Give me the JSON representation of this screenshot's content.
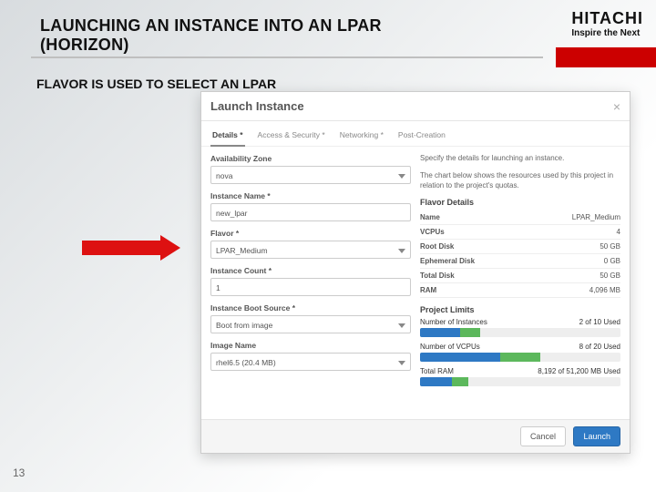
{
  "slide": {
    "title": "LAUNCHING AN INSTANCE INTO AN LPAR (HORIZON)",
    "subtitle": "FLAVOR IS USED TO SELECT AN LPAR",
    "page_number": "13"
  },
  "brand": {
    "logo": "HITACHI",
    "tagline": "Inspire the Next"
  },
  "modal": {
    "title": "Launch Instance",
    "close_glyph": "×",
    "tabs": {
      "details": "Details *",
      "access": "Access & Security *",
      "networking": "Networking *",
      "post": "Post-Creation"
    },
    "form": {
      "avail_zone": {
        "label": "Availability Zone",
        "value": "nova"
      },
      "instance_name": {
        "label": "Instance Name *",
        "value": "new_lpar"
      },
      "flavor": {
        "label": "Flavor *",
        "value": "LPAR_Medium"
      },
      "instance_count": {
        "label": "Instance Count *",
        "value": "1"
      },
      "boot_source": {
        "label": "Instance Boot Source *",
        "value": "Boot from image"
      },
      "image_name": {
        "label": "Image Name",
        "value": "rhel6.5 (20.4 MB)"
      }
    },
    "right": {
      "desc1": "Specify the details for launching an instance.",
      "desc2": "The chart below shows the resources used by this project in relation to the project's quotas.",
      "flavor_title": "Flavor Details",
      "flavor_rows": {
        "name_l": "Name",
        "name_v": "LPAR_Medium",
        "vcpu_l": "VCPUs",
        "vcpu_v": "4",
        "root_l": "Root Disk",
        "root_v": "50 GB",
        "eph_l": "Ephemeral Disk",
        "eph_v": "0 GB",
        "total_l": "Total Disk",
        "total_v": "50 GB",
        "ram_l": "RAM",
        "ram_v": "4,096 MB"
      },
      "limits_title": "Project Limits",
      "quota_inst": {
        "label": "Number of Instances",
        "text": "2 of 10 Used"
      },
      "quota_vcpu": {
        "label": "Number of VCPUs",
        "text": "8 of 20 Used"
      },
      "quota_ram": {
        "label": "Total RAM",
        "text": "8,192 of 51,200 MB Used"
      }
    },
    "footer": {
      "cancel": "Cancel",
      "launch": "Launch"
    }
  },
  "quota_colors": {
    "used": "#2e79c4",
    "adding": "#5cb85c",
    "free": "#eeeeee"
  }
}
